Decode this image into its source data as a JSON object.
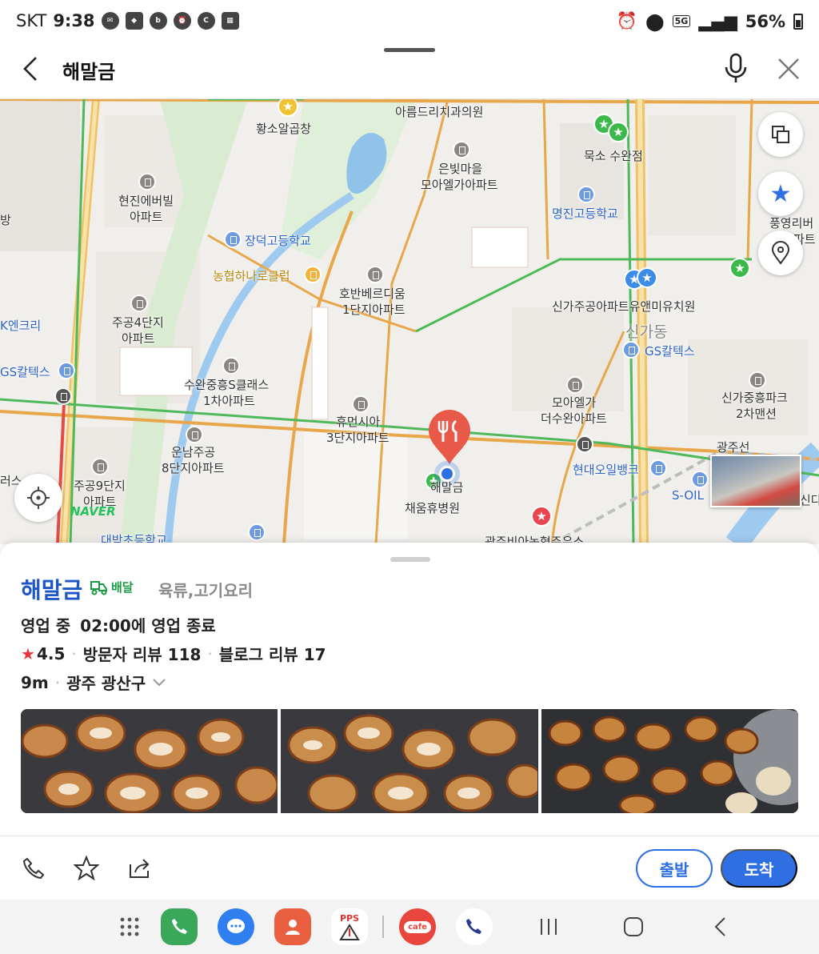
{
  "status_bar": {
    "carrier": "SKT",
    "time": "9:38",
    "network": "5G",
    "battery": "56%"
  },
  "header": {
    "title": "해말금"
  },
  "map": {
    "labels": {
      "hwangso": "황소알곱창",
      "areumdeuri": "아름드리치과의원",
      "eunbit": "은빛마을",
      "eunbit2": "모아엘가아파트",
      "mukso": "묵소 수완점",
      "hyunjin": "현진에버빌",
      "hyunjin2": "아파트",
      "myungjin": "명진고등학교",
      "pung": "풍영리버",
      "pung2": "파트",
      "bang": "방",
      "jangdeok": "장덕고등학교",
      "nonghyup": "농협하나로클럽",
      "hoban": "호반베르디움",
      "hoban2": "1단지아파트",
      "singa_kinder": "신가주공아파트유앤미유치원",
      "jugong4": "주공4단지",
      "jugong4b": "아파트",
      "kenc": "K엔크리",
      "singadong": "신가동",
      "gs1": "GS칼텍스",
      "gs2": "GS칼텍스",
      "suwan": "수완중흥S클래스",
      "suwan2": "1차아파트",
      "moael": "모아엘가",
      "moael2": "더수완아파트",
      "singajung": "신가중흥파크",
      "singajung2": "2차맨션",
      "humen": "휴먼시아",
      "humen2": "3단지아파트",
      "gwangju_line": "광주선",
      "unnam": "운남주공",
      "unnam2": "8단지아파트",
      "hyundai": "현대오일뱅크",
      "soil": "S-OIL",
      "sinda": "신다",
      "reo": "러스",
      "jugong9": "주공9단지",
      "jugong9b": "아파트",
      "haemalgeum": "해말금",
      "chaeum": "채움휴병원",
      "daebak": "대박초등학교",
      "gwangju_bia": "광주비아농협주유소",
      "naver": "NAVER"
    }
  },
  "place": {
    "name": "해말금",
    "delivery": "배달",
    "category": "육류,고기요리",
    "status": "영업 중",
    "hours": "02:00에 영업 종료",
    "rating": "4.5",
    "visitor_reviews": "방문자 리뷰 118",
    "blog_reviews": "블로그 리뷰 17",
    "distance": "9m",
    "region": "광주 광산구"
  },
  "actions": {
    "depart": "출발",
    "arrive": "도착"
  },
  "dock": {
    "pps": "PPS",
    "cafe": "cafe"
  },
  "colors": {
    "accent": "#2f6fe4",
    "place_name": "#1e56c8",
    "delivery": "#1a9b42",
    "star": "#e8363b",
    "pin": "#e8594a"
  }
}
